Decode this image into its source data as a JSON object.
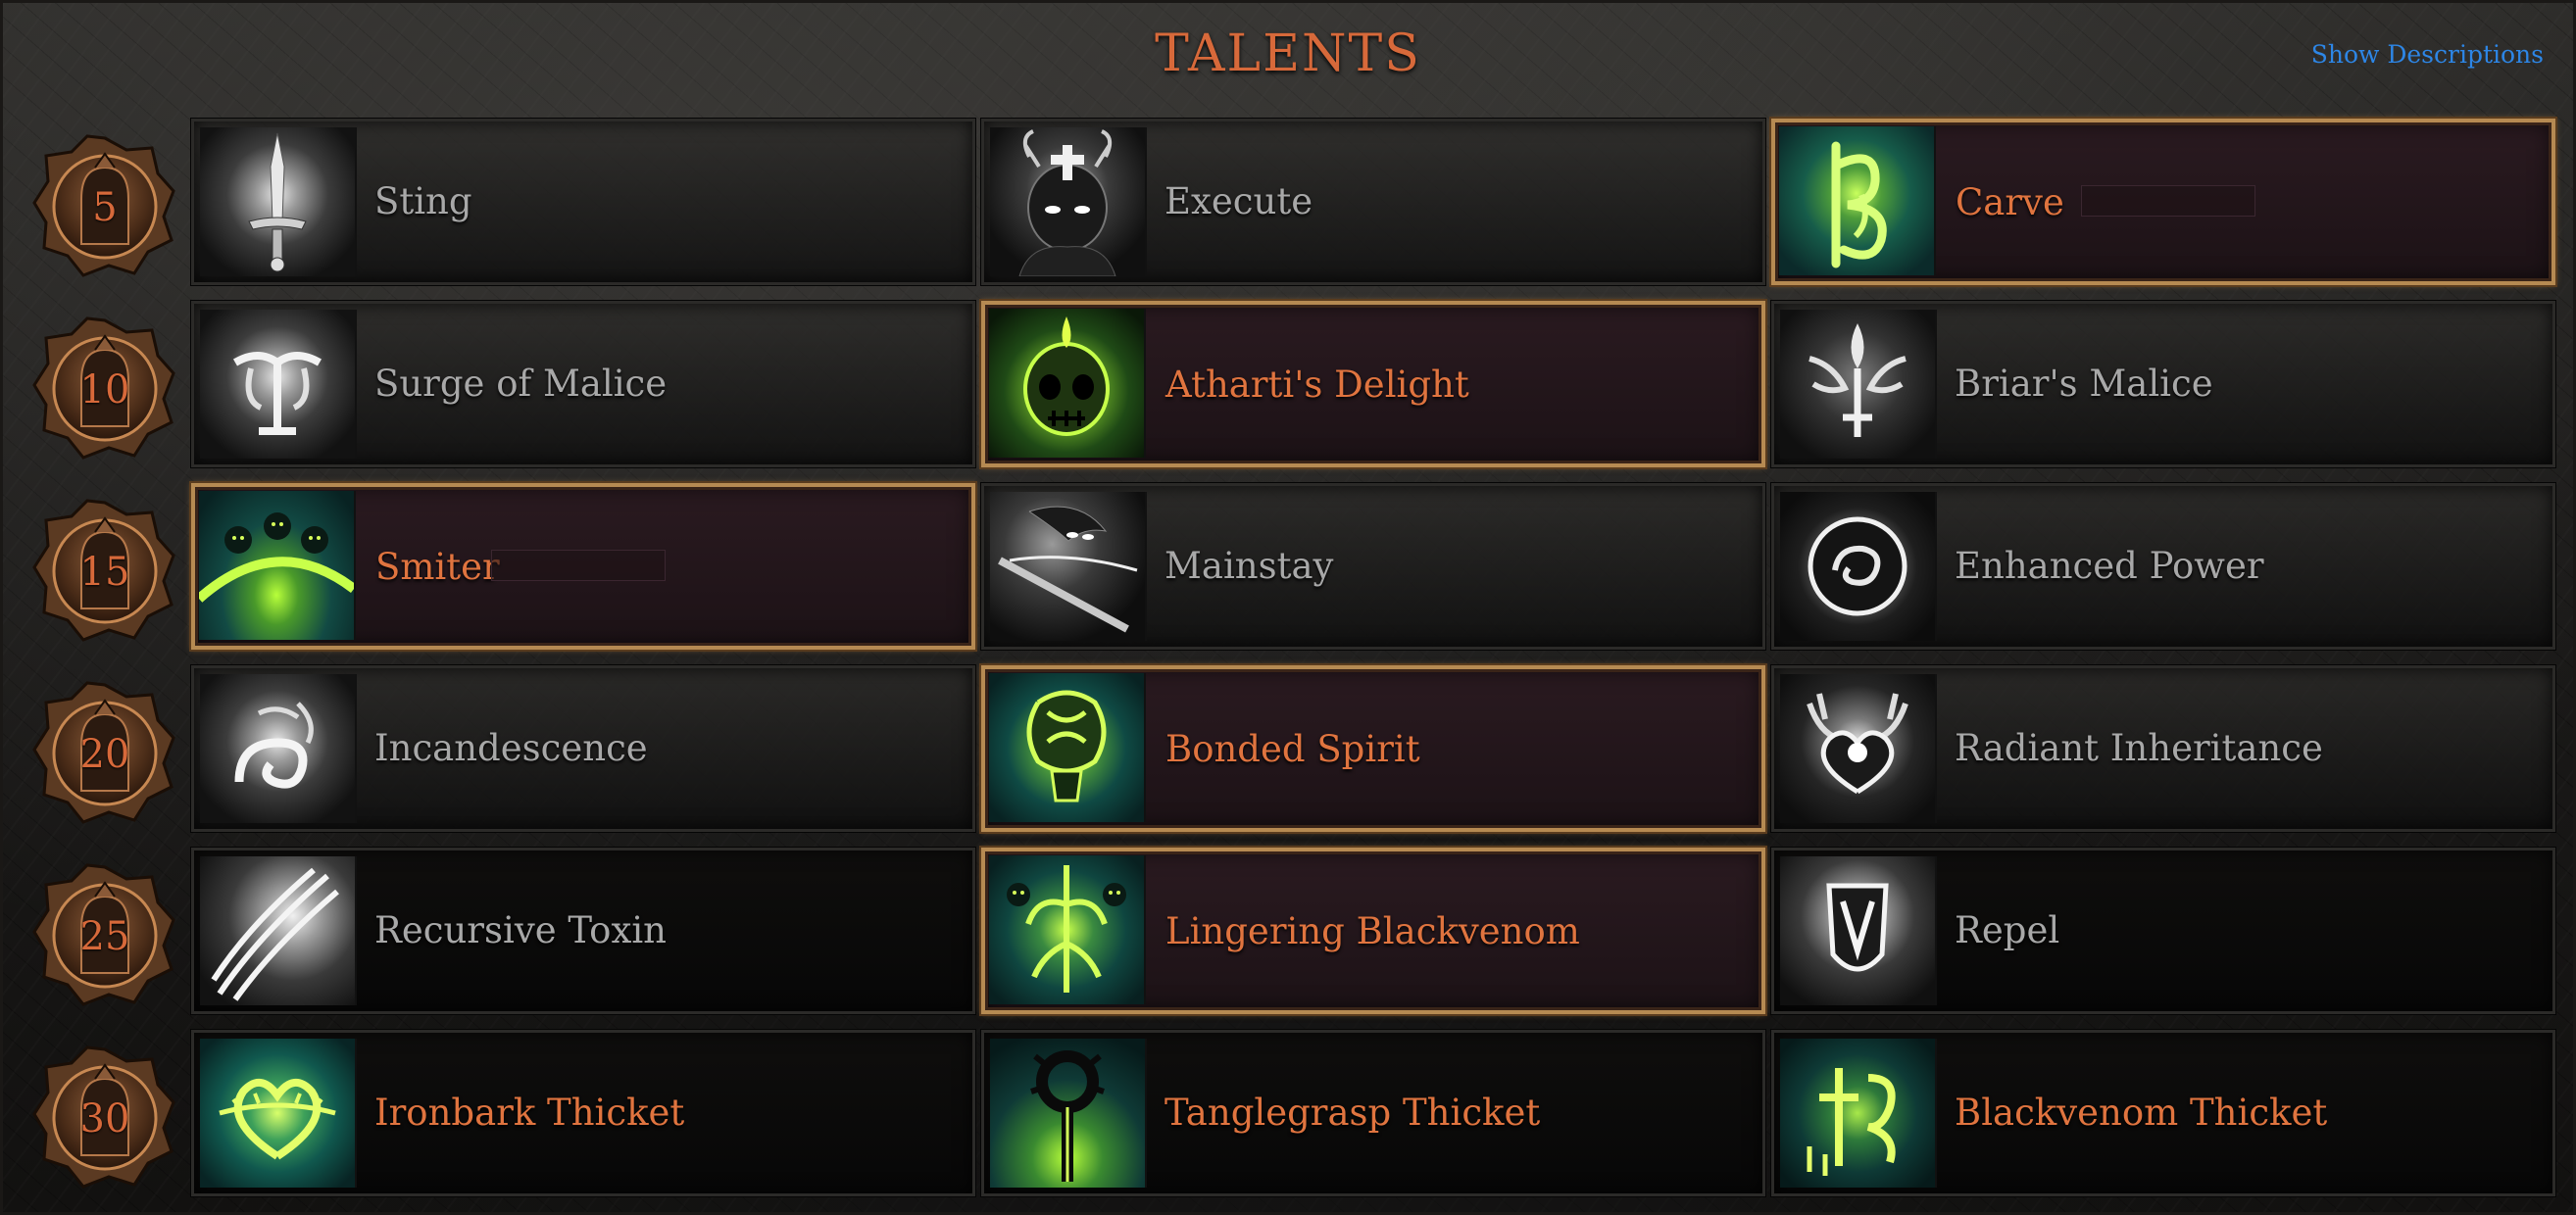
{
  "header": {
    "title": "TALENTS",
    "show_descriptions": "Show Descriptions"
  },
  "colors": {
    "accent_orange": "#d7693a",
    "link_blue": "#2d86e6",
    "selected_border": "#b68a52",
    "inactive_text": "#a8a8a8"
  },
  "rows": [
    {
      "level": "5",
      "talents": [
        {
          "name": "Sting",
          "icon": "dagger-icon",
          "selected": false
        },
        {
          "name": "Execute",
          "icon": "horned-mask-icon",
          "selected": false
        },
        {
          "name": "Carve",
          "icon": "carve-rune-icon",
          "selected": true
        }
      ]
    },
    {
      "level": "10",
      "talents": [
        {
          "name": "Surge of Malice",
          "icon": "malice-rune-icon",
          "selected": false
        },
        {
          "name": "Atharti's Delight",
          "icon": "green-skull-icon",
          "selected": true
        },
        {
          "name": "Briar's Malice",
          "icon": "briar-emblem-icon",
          "selected": false
        }
      ]
    },
    {
      "level": "15",
      "talents": [
        {
          "name": "Smiter",
          "icon": "spirit-wave-icon",
          "selected": true
        },
        {
          "name": "Mainstay",
          "icon": "hooded-figure-icon",
          "selected": false
        },
        {
          "name": "Enhanced Power",
          "icon": "power-orb-icon",
          "selected": false
        }
      ]
    },
    {
      "level": "20",
      "talents": [
        {
          "name": "Incandescence",
          "icon": "swirl-rune-icon",
          "selected": false
        },
        {
          "name": "Bonded Spirit",
          "icon": "bonded-skull-icon",
          "selected": true
        },
        {
          "name": "Radiant Inheritance",
          "icon": "antler-heart-icon",
          "selected": false
        }
      ]
    },
    {
      "level": "25",
      "talents": [
        {
          "name": "Recursive Toxin",
          "icon": "claw-blade-icon",
          "selected": false
        },
        {
          "name": "Lingering Blackvenom",
          "icon": "venom-tree-icon",
          "selected": true
        },
        {
          "name": "Repel",
          "icon": "shield-icon",
          "selected": false
        }
      ]
    },
    {
      "level": "30",
      "talents": [
        {
          "name": "Ironbark Thicket",
          "icon": "thorn-heart-icon",
          "selected": false
        },
        {
          "name": "Tanglegrasp Thicket",
          "icon": "thorn-staff-icon",
          "selected": false
        },
        {
          "name": "Blackvenom Thicket",
          "icon": "venom-rune-icon",
          "selected": false
        }
      ]
    }
  ]
}
